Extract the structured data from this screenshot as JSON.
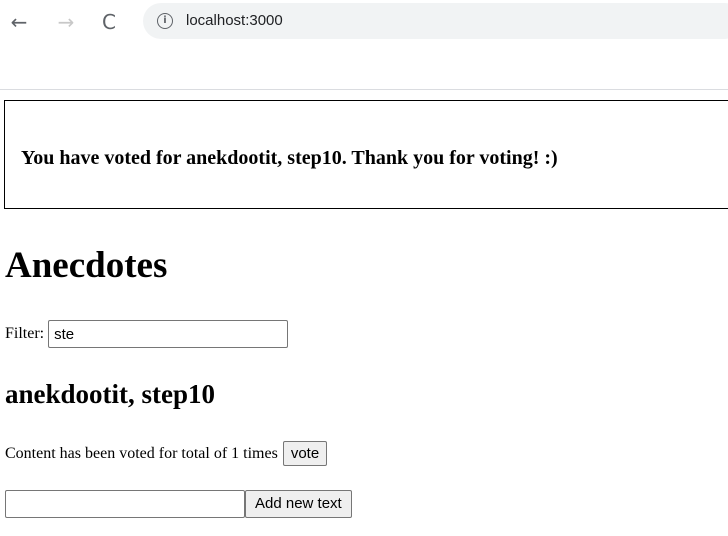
{
  "browser": {
    "back_glyph": "←",
    "forward_glyph": "→",
    "reload_glyph": "C",
    "info_glyph": "i",
    "url": "localhost:3000"
  },
  "notification": {
    "text": "You have voted for anekdootit, step10. Thank you for voting! :)"
  },
  "page": {
    "title": "Anecdotes"
  },
  "filter": {
    "label": "Filter:",
    "value": "ste"
  },
  "anecdote": {
    "title": "anekdootit, step10",
    "votes_text": "Content has been voted for total of 1 times",
    "vote_label": "vote"
  },
  "new_anecdote": {
    "value": "",
    "add_label": "Add new text"
  }
}
